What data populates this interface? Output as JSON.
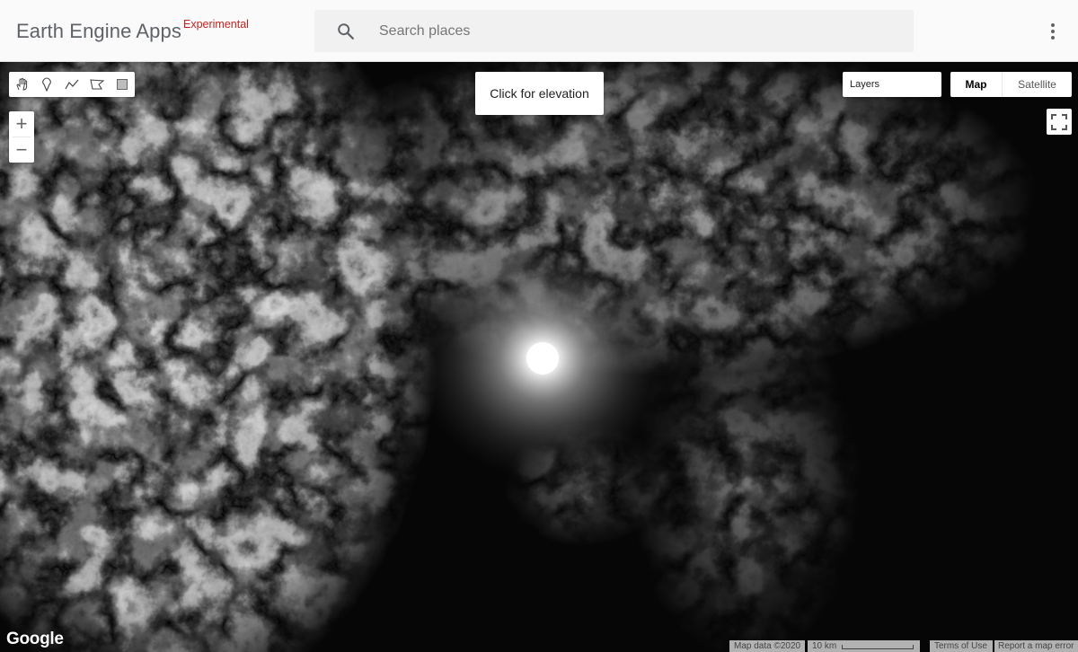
{
  "header": {
    "title": "Earth Engine Apps",
    "badge": "Experimental",
    "search_placeholder": "Search places"
  },
  "map": {
    "info_panel_text": "Click for elevation",
    "layers_label": "Layers",
    "map_type_options": [
      "Map",
      "Satellite"
    ],
    "map_type_selected": "Map",
    "zoom_in": "+",
    "zoom_out": "−",
    "drawing_tools": [
      "hand-icon",
      "marker-icon",
      "line-icon",
      "polygon-icon",
      "rectangle-icon"
    ],
    "fullscreen_icon": "fullscreen-icon",
    "google_logo": "Google",
    "attribution": {
      "map_data": "Map data ©2020",
      "scale_label": "10 km",
      "terms": "Terms of Use",
      "report": "Report a map error"
    }
  },
  "colors": {
    "badge": "#c5221f",
    "header_bg": "#fafafa",
    "search_bg": "#f1f1f1"
  }
}
